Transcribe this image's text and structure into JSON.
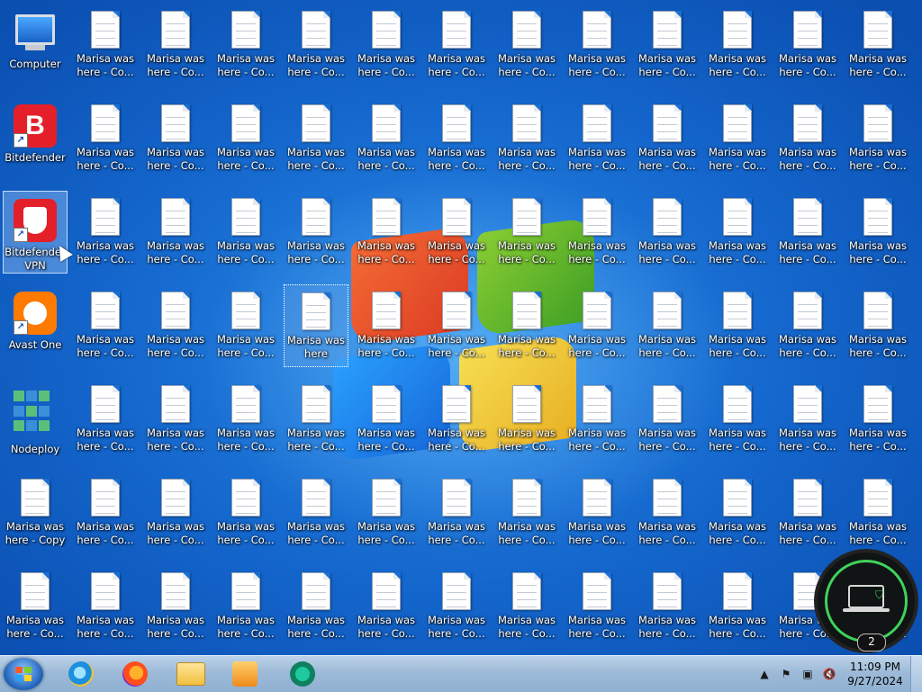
{
  "desktop": {
    "system_icons": [
      {
        "label": "Computer",
        "icon": "computer-icon"
      },
      {
        "label": "Bitdefender",
        "icon": "bitdefender-icon"
      },
      {
        "label": "Bitdefender VPN",
        "icon": "bitdefender-vpn-icon"
      },
      {
        "label": "Avast One",
        "icon": "avast-one-icon"
      },
      {
        "label": "Nodeploy",
        "icon": "nodeploy-icon"
      }
    ],
    "file_label_default": "Marisa was here - Co...",
    "file_label_col0_row5": "Marisa was here - Copy",
    "file_label_col0_row6": "Marisa was here - Co...",
    "file_label_focused": "Marisa was here"
  },
  "overlay": {
    "icon": "laptop-shield-icon",
    "count": "2",
    "ring_color": "#3fd35c"
  },
  "taskbar": {
    "start_icon": "windows-start-icon",
    "pinned": [
      {
        "name": "internet-explorer-icon"
      },
      {
        "name": "firefox-icon"
      },
      {
        "name": "file-explorer-icon"
      },
      {
        "name": "media-player-icon"
      },
      {
        "name": "bitdefender-vpn-taskbar-icon"
      }
    ],
    "tray": {
      "up_arrow": "▲",
      "flag": "⚑",
      "network": "▣",
      "volume": "🔇"
    },
    "time": "11:09 PM",
    "date": "9/27/2024"
  },
  "colors": {
    "desktop_blue": "#1b6fd3",
    "bitdefender_red": "#e3202a",
    "avast_orange": "#ff7a00"
  }
}
